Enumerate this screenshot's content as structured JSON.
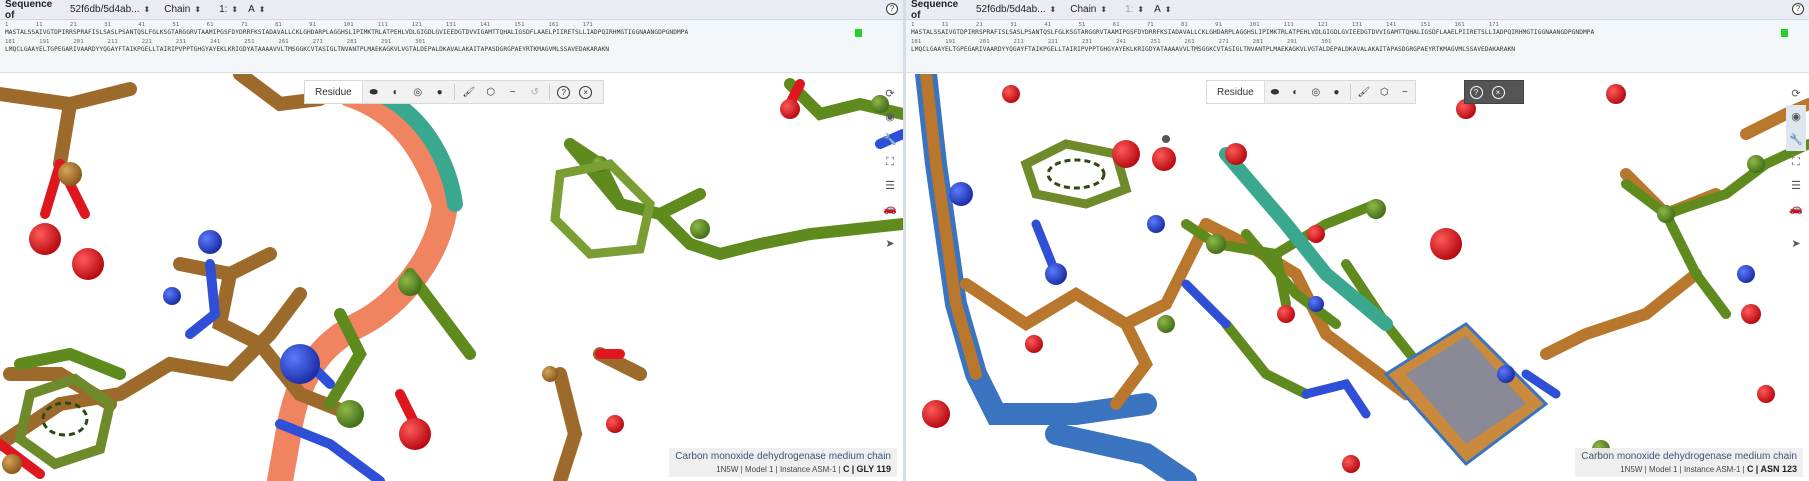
{
  "sequence_header": {
    "title": "Sequence of",
    "entry_select": "52f6db/5d4ab...",
    "chain_select": "Chain",
    "model_select": "1:",
    "asym_select": "A"
  },
  "sequence": {
    "row1_numbers": "1        11        21        31        41        51        61        71        81        91        101       111       121       131       141       151       161       171",
    "row1_residues": "MASTALSSAIVGTDPIRRSPRAFISLSASLPSANTQSLFGLKSGTARGGRVTAAMIPGSFDYDRRFKSIADAVALLCKLGHDARPLAGGHSLIPIMKTRLATPEHLVDLGIGDLGVIEEDGTDVVIGAMTTQHALIGSDFLAAELPIIRETSLLIADPQIRHMGTIGGNAANGDPGNDMPA",
    "row2_numbers": "181       191       201       211       221       231       241       251       261       271       281       291       301",
    "row2_residues": "LMQCLGAAYELTGPEGARIVAARDYYQGAYFTAIKPGELLTAIRIPVPPTGHGYAYEKLKRIGDYATAAAAVVLTMSGGKCVTASIGLTNVANTPLMAEKAGKVLVGTALDEPALDKAVALAKAITAPASDGRGPAEYRTKMAGVMLSSAVEDAKARAKN"
  },
  "toolbar": {
    "mode_label": "Residue"
  },
  "left_viewer": {
    "info_title": "Carbon monoxide dehydrogenase medium chain",
    "info_meta": "1N5W | Model 1 | Instance ASM-1 |",
    "info_chain": "C",
    "info_residue": "GLY 119"
  },
  "right_viewer": {
    "info_title": "Carbon monoxide dehydrogenase medium chain",
    "info_meta": "1N5W | Model 1 | Instance ASM-1 |",
    "info_chain": "C",
    "info_residue": "ASN 123"
  },
  "colors": {
    "chain_orange": "#b9772e",
    "chain_green": "#5e8a1e",
    "chain_blue": "#3a73c0",
    "oxygen_red": "#e0161f",
    "nitrogen_blue": "#2f4fd6",
    "highlight_green": "#23d12b"
  },
  "icons": {
    "toolbar": [
      "cartoon-icon",
      "ball-stick-icon",
      "surface-icon",
      "spacefill-icon",
      "brush-icon",
      "cube-icon",
      "minus-icon",
      "undo-icon",
      "help-icon",
      "close-icon"
    ],
    "side": [
      "rotate-icon",
      "focus-icon",
      "wrench-icon",
      "fullscreen-icon",
      "sliders-icon",
      "car-icon",
      "cursor-icon"
    ]
  }
}
